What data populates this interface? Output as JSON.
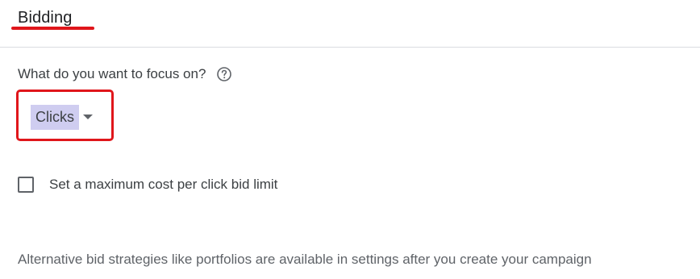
{
  "section": {
    "title": "Bidding"
  },
  "focus": {
    "question": "What do you want to focus on?",
    "help_icon": "help-circle-icon",
    "selected": "Clicks",
    "dropdown_icon": "caret-down-icon"
  },
  "bid_limit": {
    "label": "Set a maximum cost per click bid limit",
    "checked": false
  },
  "footnote": {
    "text": "Alternative bid strategies like portfolios are available in settings after you create your campaign"
  },
  "colors": {
    "annotation_red": "#e0161b",
    "selection_highlight": "#cfcdf0",
    "text": "#3c4043",
    "muted_text": "#5f6368"
  }
}
